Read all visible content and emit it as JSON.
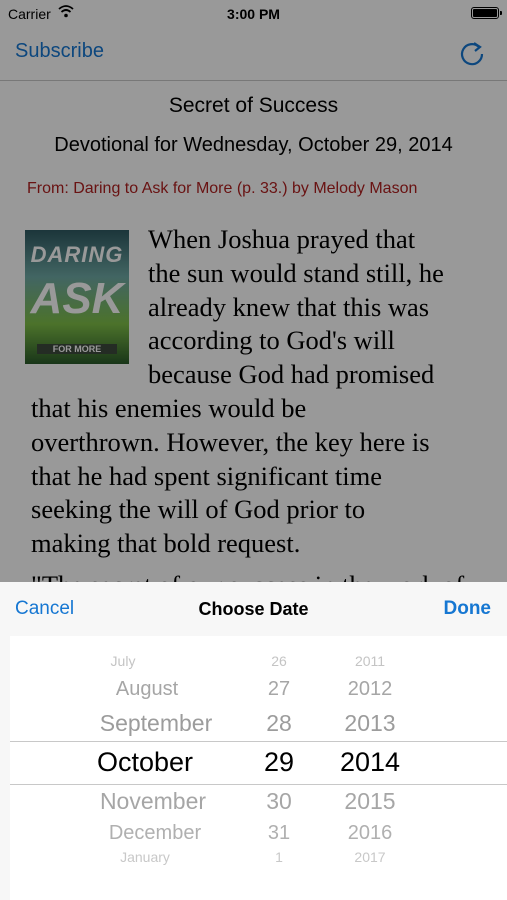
{
  "status_bar": {
    "carrier": "Carrier",
    "time": "3:00 PM"
  },
  "nav": {
    "subscribe_label": "Subscribe",
    "refresh_icon": "refresh-icon"
  },
  "article": {
    "title": "Secret of Success",
    "subtitle": "Devotional for Wednesday, October 29, 2014",
    "from": "From: Daring to Ask for More (p. 33.) by Melody Mason",
    "book_cover": {
      "title_line1": "DARING",
      "title_line2": "ASK",
      "title_line3": "FOR MORE"
    },
    "lines": [
      "When Joshua prayed that",
      "the sun would stand still, he",
      "already knew that this was",
      "according to God's will",
      "because God had promised",
      "that his enemies would be",
      "overthrown. However, the key here is",
      "that he had spent significant time",
      "seeking the will of God prior to",
      "making that bold request.",
      "\"The secret of our success in the work of"
    ]
  },
  "date_sheet": {
    "cancel_label": "Cancel",
    "title": "Choose Date",
    "done_label": "Done",
    "months": [
      "July",
      "August",
      "September",
      "October",
      "November",
      "December",
      "January"
    ],
    "days": [
      "26",
      "27",
      "28",
      "29",
      "30",
      "31",
      "1"
    ],
    "years": [
      "2011",
      "2012",
      "2013",
      "2014",
      "2015",
      "2016",
      "2017"
    ],
    "selected": {
      "month": "October",
      "day": "29",
      "year": "2014"
    }
  },
  "colors": {
    "tint": "#1677d2",
    "attribution": "#b02020",
    "overlay": "rgba(0,0,0,0.4)"
  }
}
